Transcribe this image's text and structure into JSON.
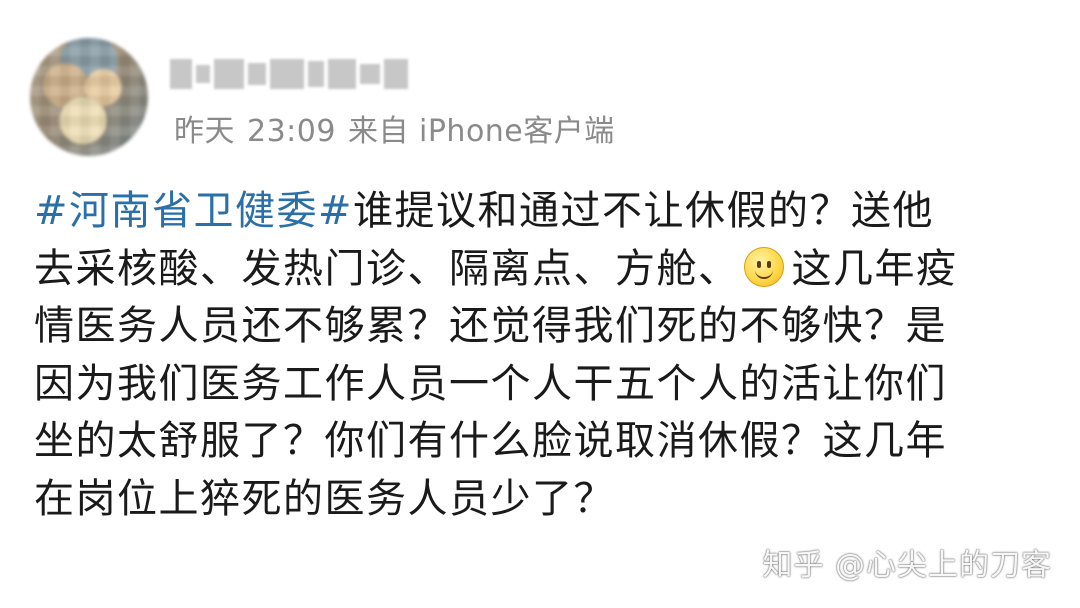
{
  "post": {
    "user": {
      "avatar_icon": "blurred-avatar",
      "username_blurred": true
    },
    "meta": {
      "date": "昨天",
      "time": "23:09",
      "source": "来自 iPhone客户端"
    },
    "lines": [
      {
        "topic": "#河南省卫健委#",
        "text": "谁提议和通过不让休假的？送他"
      },
      {
        "text": "去采核酸、发热门诊、隔离点、方舱、",
        "emoji": "smile-emoji",
        "text_after": "这几年疫"
      },
      {
        "text": "情医务人员还不够累？还觉得我们死的不够快？是"
      },
      {
        "text": "因为我们医务工作人员一个人干五个人的活让你们"
      },
      {
        "text": "坐的太舒服了？你们有什么脸说取消休假？这几年"
      },
      {
        "text": "在岗位上猝死的医务人员少了？"
      }
    ],
    "topic_color": "#2a6fa8"
  },
  "watermark": "知乎 @心尖上的刀客"
}
